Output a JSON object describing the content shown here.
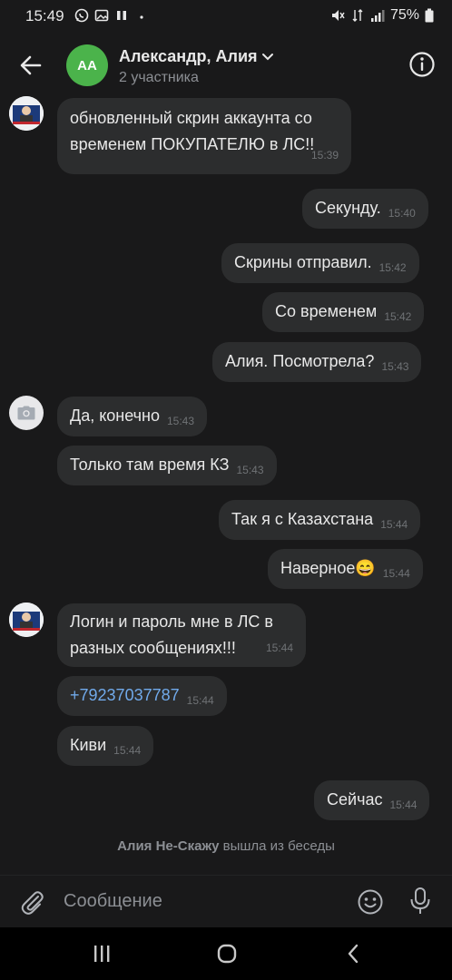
{
  "status": {
    "time": "15:49",
    "battery": "75%"
  },
  "header": {
    "avatar_initials": "АА",
    "title": "Александр, Алия",
    "subtitle": "2 участника"
  },
  "messages": [
    {
      "text": "обновленный скрин аккаунта со\nвременем ПОКУПАТЕЛЮ в ЛС!!",
      "time": "15:39",
      "side": "in"
    },
    {
      "text": "Секунду.",
      "time": "15:40",
      "side": "out"
    },
    {
      "text": "Скрины отправил.",
      "time": "15:42",
      "side": "out"
    },
    {
      "text": "Со временем",
      "time": "15:42",
      "side": "out"
    },
    {
      "text": "Алия. Посмотрела?",
      "time": "15:43",
      "side": "out"
    },
    {
      "text": "Да, конечно",
      "time": "15:43",
      "side": "in"
    },
    {
      "text": "Только там время КЗ",
      "time": "15:43",
      "side": "in"
    },
    {
      "text": "Так я с Казахстана",
      "time": "15:44",
      "side": "out"
    },
    {
      "text": "Наверное😄",
      "time": "15:44",
      "side": "out"
    },
    {
      "text": "Логин и пароль мне в ЛС в\nразных сообщениях!!!",
      "time": "15:44",
      "side": "in"
    },
    {
      "text": "+79237037787",
      "time": "15:44",
      "side": "in"
    },
    {
      "text": "Киви",
      "time": "15:44",
      "side": "in"
    },
    {
      "text": "Сейчас",
      "time": "15:44",
      "side": "out"
    }
  ],
  "system": {
    "name": "Алия Не-Скажу",
    "action": " вышла из беседы"
  },
  "composer": {
    "placeholder": "Сообщение"
  },
  "colors": {
    "background": "#19191a",
    "bubble": "#2c2d2e",
    "avatar_green": "#4bb34b",
    "link": "#71aaeb"
  }
}
